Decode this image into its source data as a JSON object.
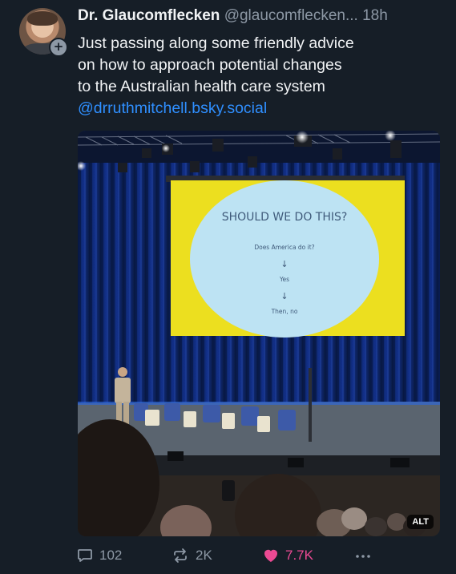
{
  "post": {
    "author": {
      "display_name": "Dr. Glaucomflecken",
      "handle": "@glaucomflecken...",
      "avatar_icon": "avatar-photo",
      "follow_badge": "+"
    },
    "time": "18h",
    "text_lines": [
      "Just passing along some friendly advice",
      "on how to approach potential changes",
      "to the Australian health care system"
    ],
    "mention": "@drruthmitchell.bsky.social",
    "image": {
      "alt_badge": "ALT",
      "slide": {
        "title": "SHOULD WE DO THIS?",
        "line1": "Does America do it?",
        "arrow1": "↓",
        "line2": "Yes",
        "arrow2": "↓",
        "line3": "Then, no"
      }
    },
    "actions": {
      "replies": "102",
      "reposts": "2K",
      "likes": "7.7K",
      "more_icon": "ellipsis-icon"
    }
  },
  "colors": {
    "background": "#161e27",
    "text": "#f1f3f5",
    "muted": "#8d98a5",
    "link": "#2f8fff",
    "like": "#ec4a93",
    "slide_yellow": "#ecdf1f",
    "slide_blue": "#bde3f3"
  }
}
